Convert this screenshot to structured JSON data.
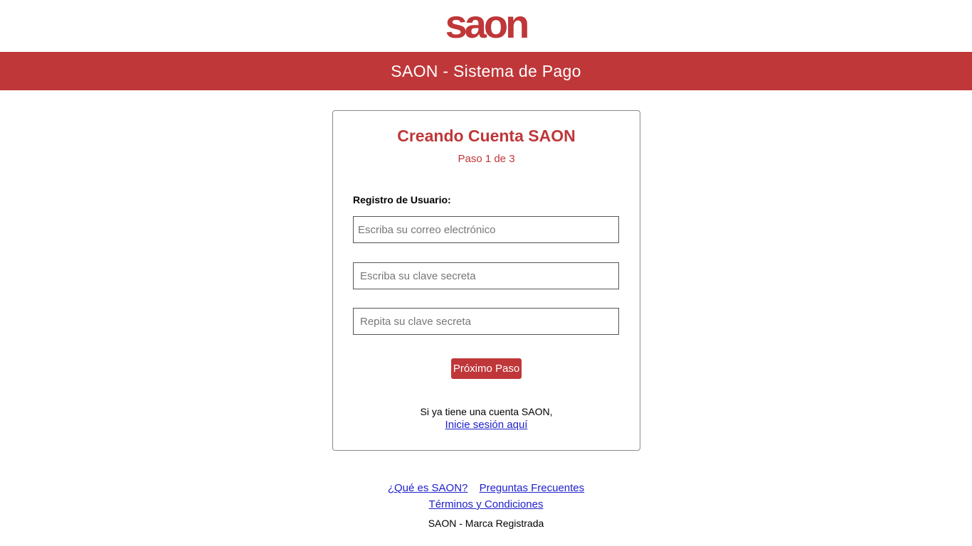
{
  "brand": {
    "logo_text": "saon",
    "color": "#bf3739"
  },
  "header": {
    "title": "SAON - Sistema de Pago"
  },
  "card": {
    "title": "Creando Cuenta SAON",
    "step": "Paso 1 de 3",
    "section_label": "Registro de Usuario:",
    "email_placeholder": "Escriba su correo electrónico",
    "password_placeholder": "Escriba su clave secreta",
    "repeat_password_placeholder": "Repita su clave secreta",
    "next_button": "Próximo Paso",
    "have_account_text": "Si ya tiene una cuenta SAON,",
    "login_link": "Inicie sesión aquí"
  },
  "footer": {
    "links": [
      "¿Qué es SAON?",
      "Preguntas Frecuentes",
      "Términos y Condiciones"
    ],
    "brand_text": "SAON - Marca Registrada"
  }
}
